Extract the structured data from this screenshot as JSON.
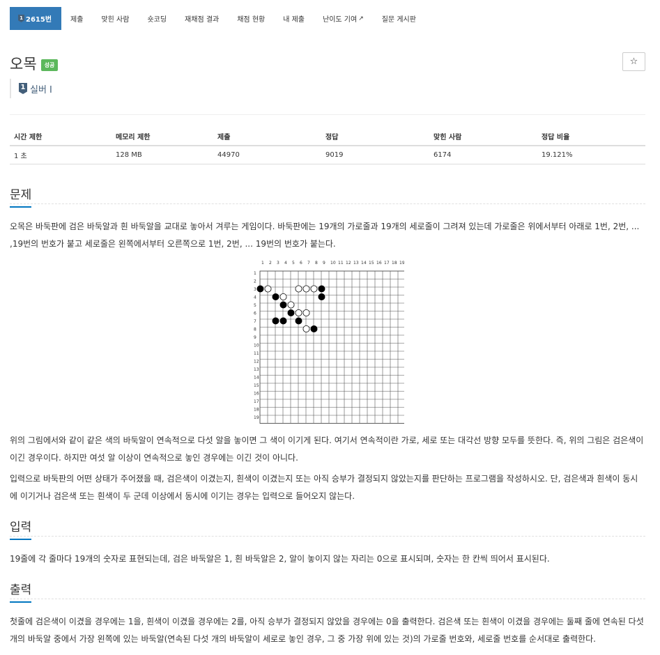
{
  "nav": {
    "problem_tab": "2615번",
    "tabs": [
      "제출",
      "맞힌 사람",
      "숏코딩",
      "재채점 결과",
      "채점 현황",
      "내 제출",
      "난이도 기여",
      "질문 게시판"
    ]
  },
  "problem": {
    "title": "오목",
    "status_badge": "성공",
    "tier_number": "1",
    "tier_label": "실버 I",
    "star_icon": "☆"
  },
  "stats": {
    "headers": [
      "시간 제한",
      "메모리 제한",
      "제출",
      "정답",
      "맞힌 사람",
      "정답 비율"
    ],
    "values": [
      "1 초",
      "128 MB",
      "44970",
      "9019",
      "6174",
      "19.121%"
    ]
  },
  "sections": {
    "problem_heading": "문제",
    "problem_text_1": "오목은 바둑판에 검은 바둑알과 흰 바둑알을 교대로 놓아서 겨루는 게임이다. 바둑판에는 19개의 가로줄과 19개의 세로줄이 그려져 있는데 가로줄은 위에서부터 아래로 1번, 2번, ... ,19번의 번호가 붙고 세로줄은 왼쪽에서부터 오른쪽으로 1번, 2번, ... 19번의 번호가 붙는다.",
    "problem_text_2": "위의 그림에서와 같이 같은 색의 바둑알이 연속적으로 다섯 알을 놓이면 그 색이 이기게 된다. 여기서 연속적이란 가로, 세로 또는 대각선 방향 모두를 뜻한다. 즉, 위의 그림은 검은색이 이긴 경우이다. 하지만 여섯 알 이상이 연속적으로 놓인 경우에는 이긴 것이 아니다.",
    "problem_text_3": "입력으로 바둑판의 어떤 상태가 주어졌을 때, 검은색이 이겼는지, 흰색이 이겼는지 또는 아직 승부가 결정되지 않았는지를 판단하는 프로그램을 작성하시오. 단, 검은색과 흰색이 동시에 이기거나 검은색 또는 흰색이 두 군데 이상에서 동시에 이기는 경우는 입력으로 들어오지 않는다.",
    "input_heading": "입력",
    "input_text": "19줄에 각 줄마다 19개의 숫자로 표현되는데, 검은 바둑알은 1, 흰 바둑알은 2, 알이 놓이지 않는 자리는 0으로 표시되며, 숫자는 한 칸씩 띄어서 표시된다.",
    "output_heading": "출력",
    "output_text": "첫줄에 검은색이 이겼을 경우에는 1을, 흰색이 이겼을 경우에는 2를, 아직 승부가 결정되지 않았을 경우에는 0을 출력한다. 검은색 또는 흰색이 이겼을 경우에는 둘째 줄에 연속된 다섯 개의 바둑알 중에서 가장 왼쪽에 있는 바둑알(연속된 다섯 개의 바둑알이 세로로 놓인 경우, 그 중 가장 위에 있는 것)의 가로줄 번호와, 세로줄 번호를 순서대로 출력한다."
  },
  "board": {
    "size": 19,
    "black": [
      [
        3,
        1
      ],
      [
        3,
        9
      ],
      [
        4,
        3
      ],
      [
        4,
        9
      ],
      [
        5,
        4
      ],
      [
        6,
        5
      ],
      [
        7,
        3
      ],
      [
        7,
        4
      ],
      [
        7,
        6
      ],
      [
        8,
        8
      ]
    ],
    "white": [
      [
        3,
        2
      ],
      [
        3,
        6
      ],
      [
        3,
        7
      ],
      [
        3,
        8
      ],
      [
        4,
        4
      ],
      [
        5,
        5
      ],
      [
        6,
        6
      ],
      [
        6,
        7
      ],
      [
        8,
        7
      ]
    ]
  }
}
